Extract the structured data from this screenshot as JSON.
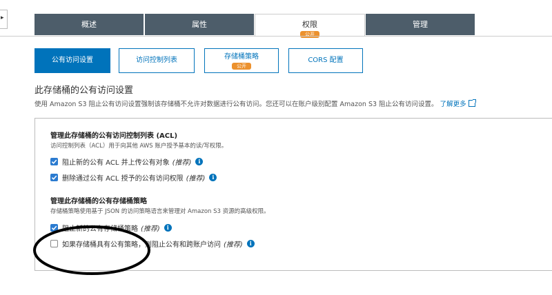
{
  "top_tabs": [
    {
      "label": "概述"
    },
    {
      "label": "属性"
    },
    {
      "label": "权限",
      "badge": "公开"
    },
    {
      "label": "管理"
    }
  ],
  "sub_tabs": [
    {
      "label": "公有访问设置"
    },
    {
      "label": "访问控制列表"
    },
    {
      "label": "存储桶策略",
      "badge": "公开"
    },
    {
      "label": "CORS 配置"
    }
  ],
  "section": {
    "title": "此存储桶的公有访问设置",
    "description": "使用 Amazon S3 阻止公有访问设置强制该存储桶不允许对数据进行公有访问。您还可以在账户级别配置 Amazon S3 阻止公有访问设置。",
    "learn_more": "了解更多"
  },
  "acl_group": {
    "title": "管理此存储桶的公有访问控制列表 (ACL)",
    "description": "访问控制列表（ACL）用于向其他 AWS 账户授予基本的读/写权限。",
    "options": [
      {
        "label": "阻止新的公有 ACL 并上传公有对象",
        "recommended": "(推荐)",
        "checked": true
      },
      {
        "label": "删除通过公有 ACL 授予的公有访问权限",
        "recommended": "(推荐)",
        "checked": true
      }
    ]
  },
  "policy_group": {
    "title": "管理此存储桶的公有存储桶策略",
    "description": "存储桶策略使用基于 JSON 的访问策略语言来管理对 Amazon S3 资源的高级权限。",
    "options": [
      {
        "label": "阻止新的公有存储桶策略",
        "recommended": "(推荐)",
        "checked": true
      },
      {
        "label": "如果存储桶具有公有策略，则阻止公有和跨账户访问",
        "recommended": "(推荐)",
        "checked": false
      }
    ]
  },
  "info_icon_glyph": "i",
  "colors": {
    "tab_dark": "#4d5d6a",
    "accent_blue": "#0073bb",
    "badge_orange": "#ec912d"
  }
}
